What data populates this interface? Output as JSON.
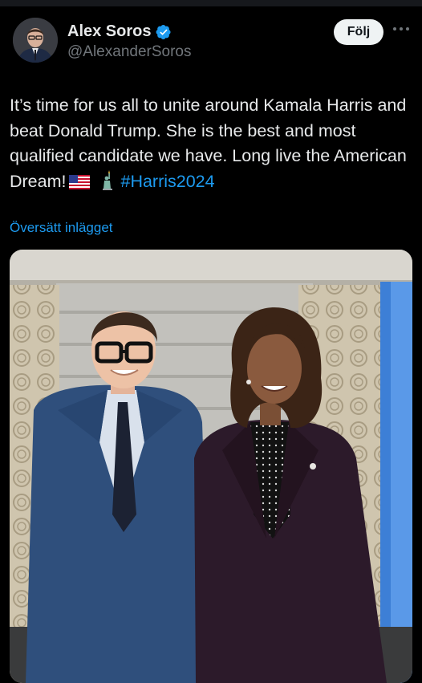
{
  "author": {
    "display_name": "Alex Soros",
    "handle": "@AlexanderSoros",
    "verified": true,
    "avatar_icon": "profile-photo"
  },
  "actions": {
    "follow_label": "Följ",
    "more_icon": "more-horizontal-icon"
  },
  "tweet": {
    "text_part1": "It’s time for us all to unite around Kamala Harris and beat Donald Trump. She is the best and most qualified candidate we have. Long live the American Dream!",
    "emoji_1": "us-flag",
    "emoji_2": "statue-of-liberty",
    "hashtag": "#Harris2024"
  },
  "translate_label": "Översätt inlägget",
  "colors": {
    "background": "#000000",
    "text": "#e7e9ea",
    "secondary": "#71767b",
    "link": "#1d9bf0",
    "follow_bg": "#eff3f4"
  }
}
